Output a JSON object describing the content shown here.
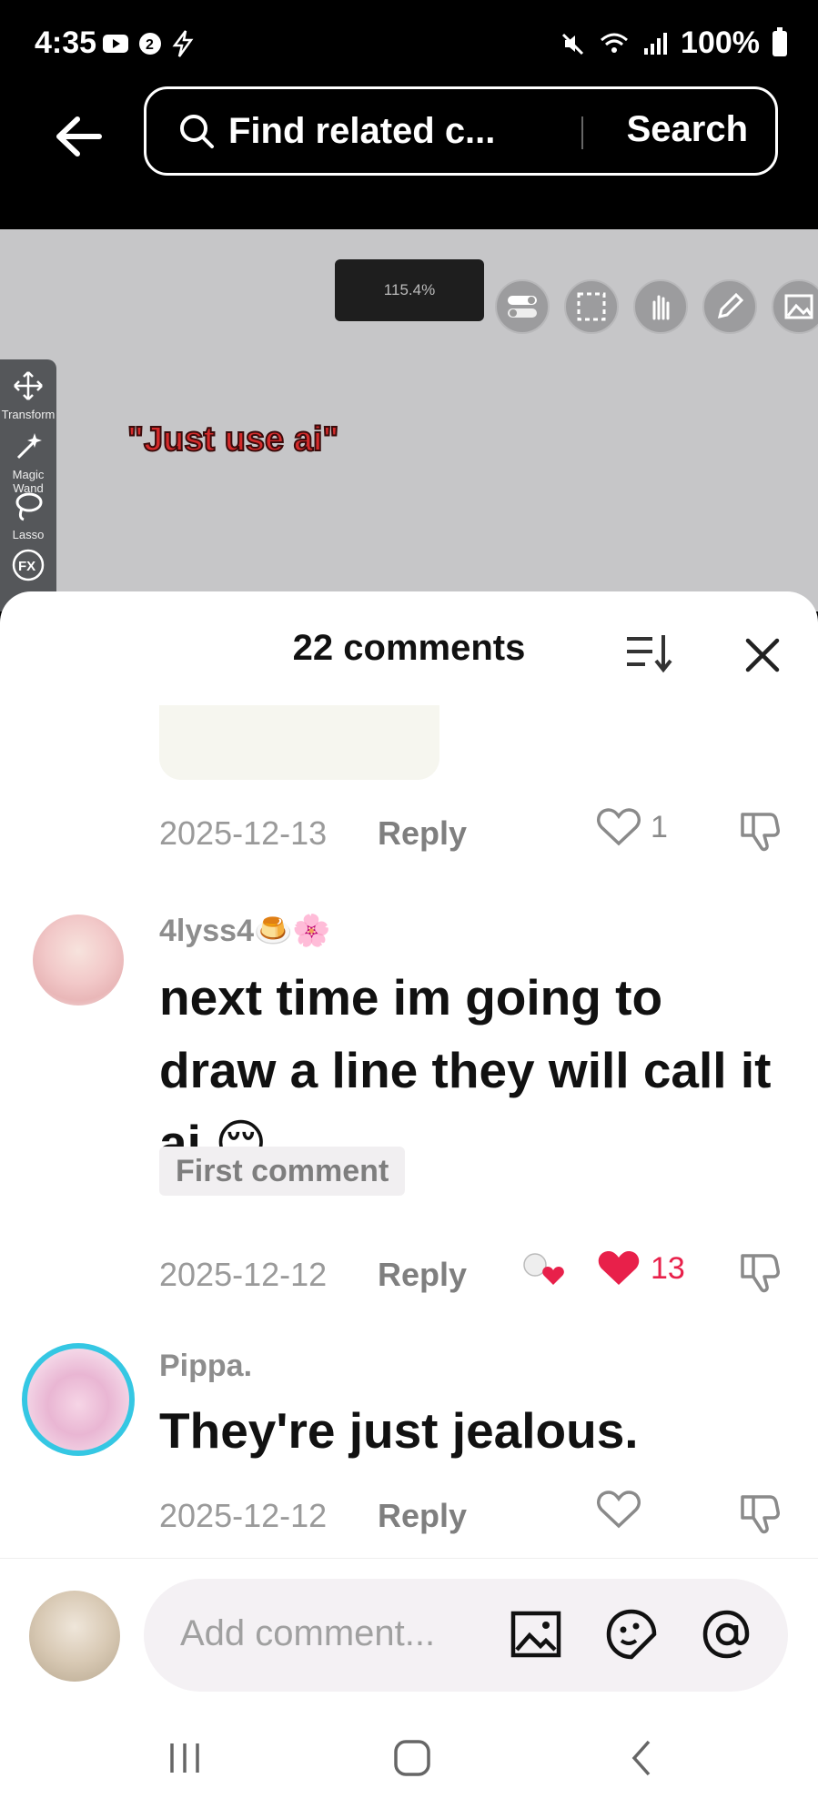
{
  "status_bar": {
    "time": "4:35",
    "battery": "100%"
  },
  "search": {
    "query_preview": "Find related c...",
    "button_label": "Search"
  },
  "video": {
    "zoom": "115.4%",
    "caption": "\"Just use ai\"",
    "tools": [
      "Transform",
      "Magic Wand",
      "Lasso",
      "FX"
    ]
  },
  "comments_sheet": {
    "title": "22 comments",
    "prev_comment": {
      "date": "2025-12-13",
      "reply": "Reply",
      "likes": "1"
    },
    "comments": [
      {
        "username": "4lyss4",
        "username_emoji": "🍮🌸",
        "text": "next time im going to draw a line they will call it ai.😌",
        "badge": "First comment",
        "date": "2025-12-12",
        "reply": "Reply",
        "likes": "13"
      },
      {
        "username": "Pippa.",
        "text": "They're just jealous.",
        "date": "2025-12-12",
        "reply": "Reply"
      }
    ]
  },
  "comment_input": {
    "placeholder": "Add comment..."
  },
  "colors": {
    "liked": "#e8204a",
    "sheet": "#ffffff",
    "header": "#000000"
  },
  "icons": [
    "back-arrow-icon",
    "search-icon",
    "sort-icon",
    "close-icon",
    "heart-icon",
    "dislike-icon",
    "image-icon",
    "sticker-icon",
    "mention-icon",
    "recent-apps-icon",
    "home-icon",
    "back-icon"
  ]
}
